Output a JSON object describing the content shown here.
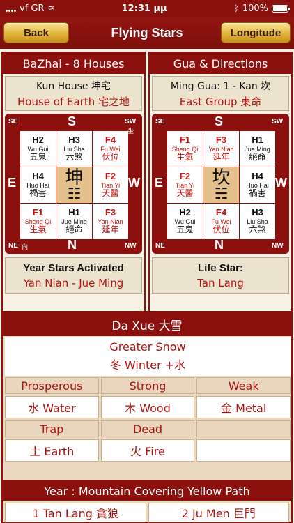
{
  "status_bar": {
    "carrier": "vf GR",
    "time": "12:31 μμ",
    "battery": "100%"
  },
  "nav": {
    "back_label": "Back",
    "title": "Flying Stars",
    "longitude_label": "Longitude"
  },
  "bazhai": {
    "header": "BaZhai - 8 Houses",
    "house_name": "Kun House 坤宅",
    "house_desc": "House of Earth 宅之地",
    "compass": {
      "top_left": "SE",
      "top": "S",
      "top_right": "SW",
      "top_right_mark": "坐",
      "left": "E",
      "right": "W",
      "bottom_left": "NE",
      "bottom_left_mark": "向",
      "bottom": "N",
      "bottom_right": "NW"
    },
    "cells": [
      {
        "code": "H2",
        "name": "Wu Gui",
        "chinese": "五鬼",
        "kind": "bad"
      },
      {
        "code": "H3",
        "name": "Liu Sha",
        "chinese": "六煞",
        "kind": "bad"
      },
      {
        "code": "F4",
        "name": "Fu Wei",
        "chinese": "伏位",
        "kind": "good"
      },
      {
        "code": "H4",
        "name": "Huo Hai",
        "chinese": "禍害",
        "kind": "bad"
      },
      {
        "code": "坤",
        "name": "☷",
        "chinese": "",
        "kind": "center"
      },
      {
        "code": "F2",
        "name": "Tian Yi",
        "chinese": "天醫",
        "kind": "good"
      },
      {
        "code": "F1",
        "name": "Sheng Qi",
        "chinese": "生氣",
        "kind": "good"
      },
      {
        "code": "H1",
        "name": "Jue Ming",
        "chinese": "絕命",
        "kind": "bad"
      },
      {
        "code": "F3",
        "name": "Yan Nian",
        "chinese": "延年",
        "kind": "good"
      }
    ],
    "stars_label": "Year Stars Activated",
    "stars_value": "Yan Nian - Jue Ming"
  },
  "gua": {
    "header": "Gua & Directions",
    "ming_gua": "Ming Gua: 1 - Kan 坎",
    "group": "East Group 東命",
    "compass": {
      "top_left": "SE",
      "top": "S",
      "top_right": "SW",
      "left": "E",
      "right": "W",
      "bottom_left": "NE",
      "bottom": "N",
      "bottom_right": "NW"
    },
    "cells": [
      {
        "code": "F1",
        "name": "Sheng Qi",
        "chinese": "生氣",
        "kind": "good"
      },
      {
        "code": "F3",
        "name": "Yan Nian",
        "chinese": "延年",
        "kind": "good"
      },
      {
        "code": "H1",
        "name": "Jue Ming",
        "chinese": "絕命",
        "kind": "bad"
      },
      {
        "code": "F2",
        "name": "Tian Yi",
        "chinese": "天醫",
        "kind": "good"
      },
      {
        "code": "坎",
        "name": "☵",
        "chinese": "",
        "kind": "center"
      },
      {
        "code": "H4",
        "name": "Huo Hai",
        "chinese": "禍害",
        "kind": "bad"
      },
      {
        "code": "H2",
        "name": "Wu Gui",
        "chinese": "五鬼",
        "kind": "bad"
      },
      {
        "code": "F4",
        "name": "Fu Wei",
        "chinese": "伏位",
        "kind": "good"
      },
      {
        "code": "H3",
        "name": "Liu Sha",
        "chinese": "六煞",
        "kind": "bad"
      }
    ],
    "life_star_label": "Life Star:",
    "life_star_value": "Tan Lang"
  },
  "solar_term": {
    "header": "Da Xue 大雪",
    "name": "Greater Snow",
    "season": "冬 Winter  +水",
    "labels": [
      "Prosperous",
      "Strong",
      "Weak"
    ],
    "values": [
      "水 Water",
      "木 Wood",
      "金 Metal"
    ],
    "labels2": [
      "Trap",
      "Dead",
      ""
    ],
    "values2": [
      "土 Earth",
      "火 Fire",
      ""
    ]
  },
  "year": {
    "header": "Year : Mountain Covering Yellow Path",
    "star1": "1 Tan Lang 貪狼",
    "star2": "2 Ju Men 巨門"
  },
  "colors": {
    "accent_red": "#8c100d",
    "text_red": "#b3140f",
    "gold": "#e2b43a",
    "background": "#f4efe1"
  }
}
